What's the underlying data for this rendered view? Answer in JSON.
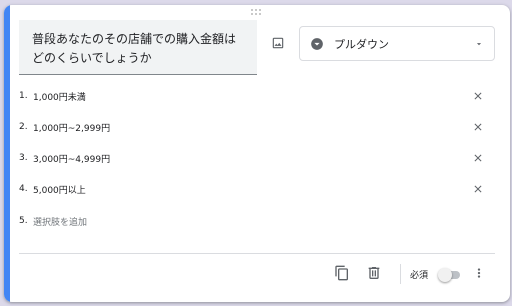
{
  "question": {
    "title": "普段あなたのその店舗での購入金額はどのくらいでしょうか"
  },
  "type_select": {
    "label": "プルダウン",
    "icon": "dropdown-circle-icon"
  },
  "options": [
    {
      "number": "1.",
      "label": "1,000円未満"
    },
    {
      "number": "2.",
      "label": "1,000円~2,999円"
    },
    {
      "number": "3.",
      "label": "3,000円~4,999円"
    },
    {
      "number": "4.",
      "label": "5,000円以上"
    }
  ],
  "add_option": {
    "number": "5.",
    "label": "選択肢を追加"
  },
  "footer": {
    "required_label": "必須",
    "required_on": false
  },
  "colors": {
    "accent": "#4285f4",
    "background": "#dcd9ea",
    "icon": "#5f6368"
  }
}
